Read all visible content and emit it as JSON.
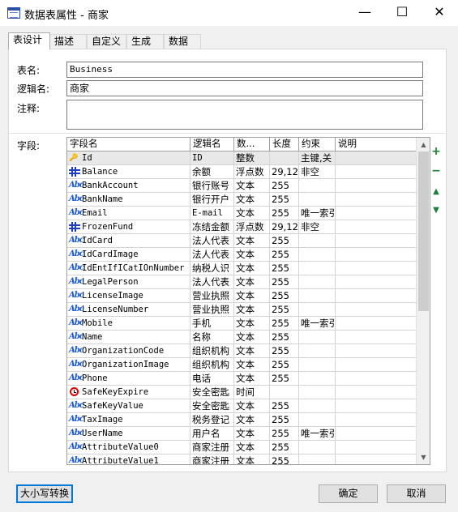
{
  "window": {
    "title": "数据表属性 - 商家"
  },
  "tabs": [
    {
      "label": "表设计",
      "active": true
    },
    {
      "label": "描述"
    },
    {
      "label": "自定义"
    },
    {
      "label": "生成"
    },
    {
      "label": "数据"
    }
  ],
  "form": {
    "table_name_label": "表名:",
    "table_name_value": "Business",
    "logic_name_label": "逻辑名:",
    "logic_name_value": "商家",
    "comment_label": "注释:",
    "comment_value": "",
    "fields_label": "字段:"
  },
  "grid": {
    "columns": [
      "字段名",
      "逻辑名",
      "数...",
      "长度",
      "约束",
      "说明"
    ],
    "rows": [
      {
        "icon": "key-icon",
        "name": "Id",
        "logic": "ID",
        "type": "整数",
        "length": "",
        "constraint": "主键,关",
        "note": ""
      },
      {
        "icon": "number-icon",
        "name": "Balance",
        "logic": "余额",
        "type": "浮点数",
        "length": "29,12",
        "constraint": "非空",
        "note": ""
      },
      {
        "icon": "text-icon",
        "name": "BankAccount",
        "logic": "银行账号",
        "type": "文本",
        "length": "255",
        "constraint": "",
        "note": ""
      },
      {
        "icon": "text-icon",
        "name": "BankName",
        "logic": "银行开户",
        "type": "文本",
        "length": "255",
        "constraint": "",
        "note": ""
      },
      {
        "icon": "text-icon",
        "name": "Email",
        "logic": "E-mail",
        "type": "文本",
        "length": "255",
        "constraint": "唯一索引",
        "note": ""
      },
      {
        "icon": "number-icon",
        "name": "FrozenFund",
        "logic": "冻结金额",
        "type": "浮点数",
        "length": "29,12",
        "constraint": "非空",
        "note": ""
      },
      {
        "icon": "text-icon",
        "name": "IdCard",
        "logic": "法人代表",
        "type": "文本",
        "length": "255",
        "constraint": "",
        "note": ""
      },
      {
        "icon": "text-icon",
        "name": "IdCardImage",
        "logic": "法人代表",
        "type": "文本",
        "length": "255",
        "constraint": "",
        "note": ""
      },
      {
        "icon": "text-icon",
        "name": "IdEntIfICatIOnNumber",
        "logic": "纳税人识",
        "type": "文本",
        "length": "255",
        "constraint": "",
        "note": ""
      },
      {
        "icon": "text-icon",
        "name": "LegalPerson",
        "logic": "法人代表",
        "type": "文本",
        "length": "255",
        "constraint": "",
        "note": ""
      },
      {
        "icon": "text-icon",
        "name": "LicenseImage",
        "logic": "营业执照",
        "type": "文本",
        "length": "255",
        "constraint": "",
        "note": ""
      },
      {
        "icon": "text-icon",
        "name": "LicenseNumber",
        "logic": "营业执照",
        "type": "文本",
        "length": "255",
        "constraint": "",
        "note": ""
      },
      {
        "icon": "text-icon",
        "name": "Mobile",
        "logic": "手机",
        "type": "文本",
        "length": "255",
        "constraint": "唯一索引",
        "note": ""
      },
      {
        "icon": "text-icon",
        "name": "Name",
        "logic": "名称",
        "type": "文本",
        "length": "255",
        "constraint": "",
        "note": ""
      },
      {
        "icon": "text-icon",
        "name": "OrganizationCode",
        "logic": "组织机构",
        "type": "文本",
        "length": "255",
        "constraint": "",
        "note": ""
      },
      {
        "icon": "text-icon",
        "name": "OrganizationImage",
        "logic": "组织机构",
        "type": "文本",
        "length": "255",
        "constraint": "",
        "note": ""
      },
      {
        "icon": "text-icon",
        "name": "Phone",
        "logic": "电话",
        "type": "文本",
        "length": "255",
        "constraint": "",
        "note": ""
      },
      {
        "icon": "time-icon",
        "name": "SafeKeyExpire",
        "logic": "安全密匙",
        "type": "时间",
        "length": "",
        "constraint": "",
        "note": ""
      },
      {
        "icon": "text-icon",
        "name": "SafeKeyValue",
        "logic": "安全密匙",
        "type": "文本",
        "length": "255",
        "constraint": "",
        "note": ""
      },
      {
        "icon": "text-icon",
        "name": "TaxImage",
        "logic": "税务登记",
        "type": "文本",
        "length": "255",
        "constraint": "",
        "note": ""
      },
      {
        "icon": "text-icon",
        "name": "UserName",
        "logic": "用户名",
        "type": "文本",
        "length": "255",
        "constraint": "唯一索引",
        "note": ""
      },
      {
        "icon": "text-icon",
        "name": "AttributeValue0",
        "logic": "商家注册",
        "type": "文本",
        "length": "255",
        "constraint": "",
        "note": ""
      },
      {
        "icon": "text-icon",
        "name": "AttributeValue1",
        "logic": "商家注册",
        "type": "文本",
        "length": "255",
        "constraint": "",
        "note": ""
      }
    ]
  },
  "side_buttons": {
    "add": "+",
    "remove": "−",
    "up": "▲",
    "down": "▼"
  },
  "footer": {
    "case_convert_label": "大小写转换",
    "ok_label": "确定",
    "cancel_label": "取消"
  }
}
